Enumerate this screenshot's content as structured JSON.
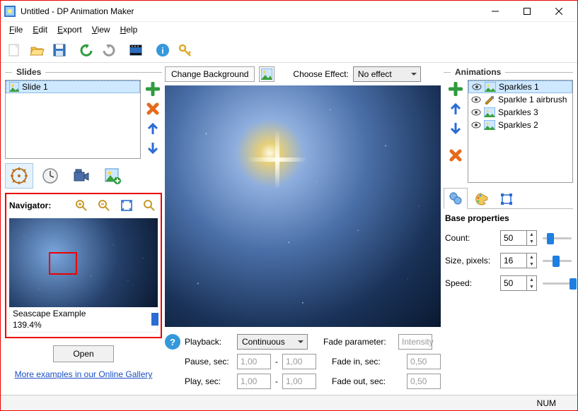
{
  "window": {
    "title": "Untitled - DP Animation Maker"
  },
  "menu": {
    "file": "File",
    "edit": "Edit",
    "export": "Export",
    "view": "View",
    "help": "Help"
  },
  "slides": {
    "title": "Slides",
    "items": [
      "Slide 1"
    ]
  },
  "navigator": {
    "title": "Navigator:",
    "caption": "Seascape Example",
    "zoom": "139.4%",
    "open": "Open",
    "gallery_link": "More examples in our Online Gallery"
  },
  "midtop": {
    "change_bg": "Change Background",
    "choose_effect": "Choose Effect:",
    "effect_value": "No effect"
  },
  "playback": {
    "label": "Playback:",
    "mode": "Continuous",
    "pause_label": "Pause, sec:",
    "pause_a": "1,00",
    "pause_b": "1,00",
    "play_label": "Play, sec:",
    "play_a": "1,00",
    "play_b": "1,00",
    "fadeparam_label": "Fade parameter:",
    "fadeparam_value": "Intensity",
    "fadein_label": "Fade in, sec:",
    "fadein_value": "0,50",
    "fadeout_label": "Fade out, sec:",
    "fadeout_value": "0,50",
    "dash": "-"
  },
  "animations": {
    "title": "Animations",
    "items": [
      {
        "name": "Sparkles 1",
        "sel": true,
        "tool": "fx"
      },
      {
        "name": "Sparkle 1 airbrush",
        "sel": false,
        "tool": "brush"
      },
      {
        "name": "Sparkles 3",
        "sel": false,
        "tool": "fx"
      },
      {
        "name": "Sparkles 2",
        "sel": false,
        "tool": "fx"
      }
    ]
  },
  "props": {
    "title": "Base properties",
    "count_label": "Count:",
    "count": "50",
    "size_label": "Size, pixels:",
    "size": "16",
    "speed_label": "Speed:",
    "speed": "50"
  },
  "status": {
    "num": "NUM"
  }
}
